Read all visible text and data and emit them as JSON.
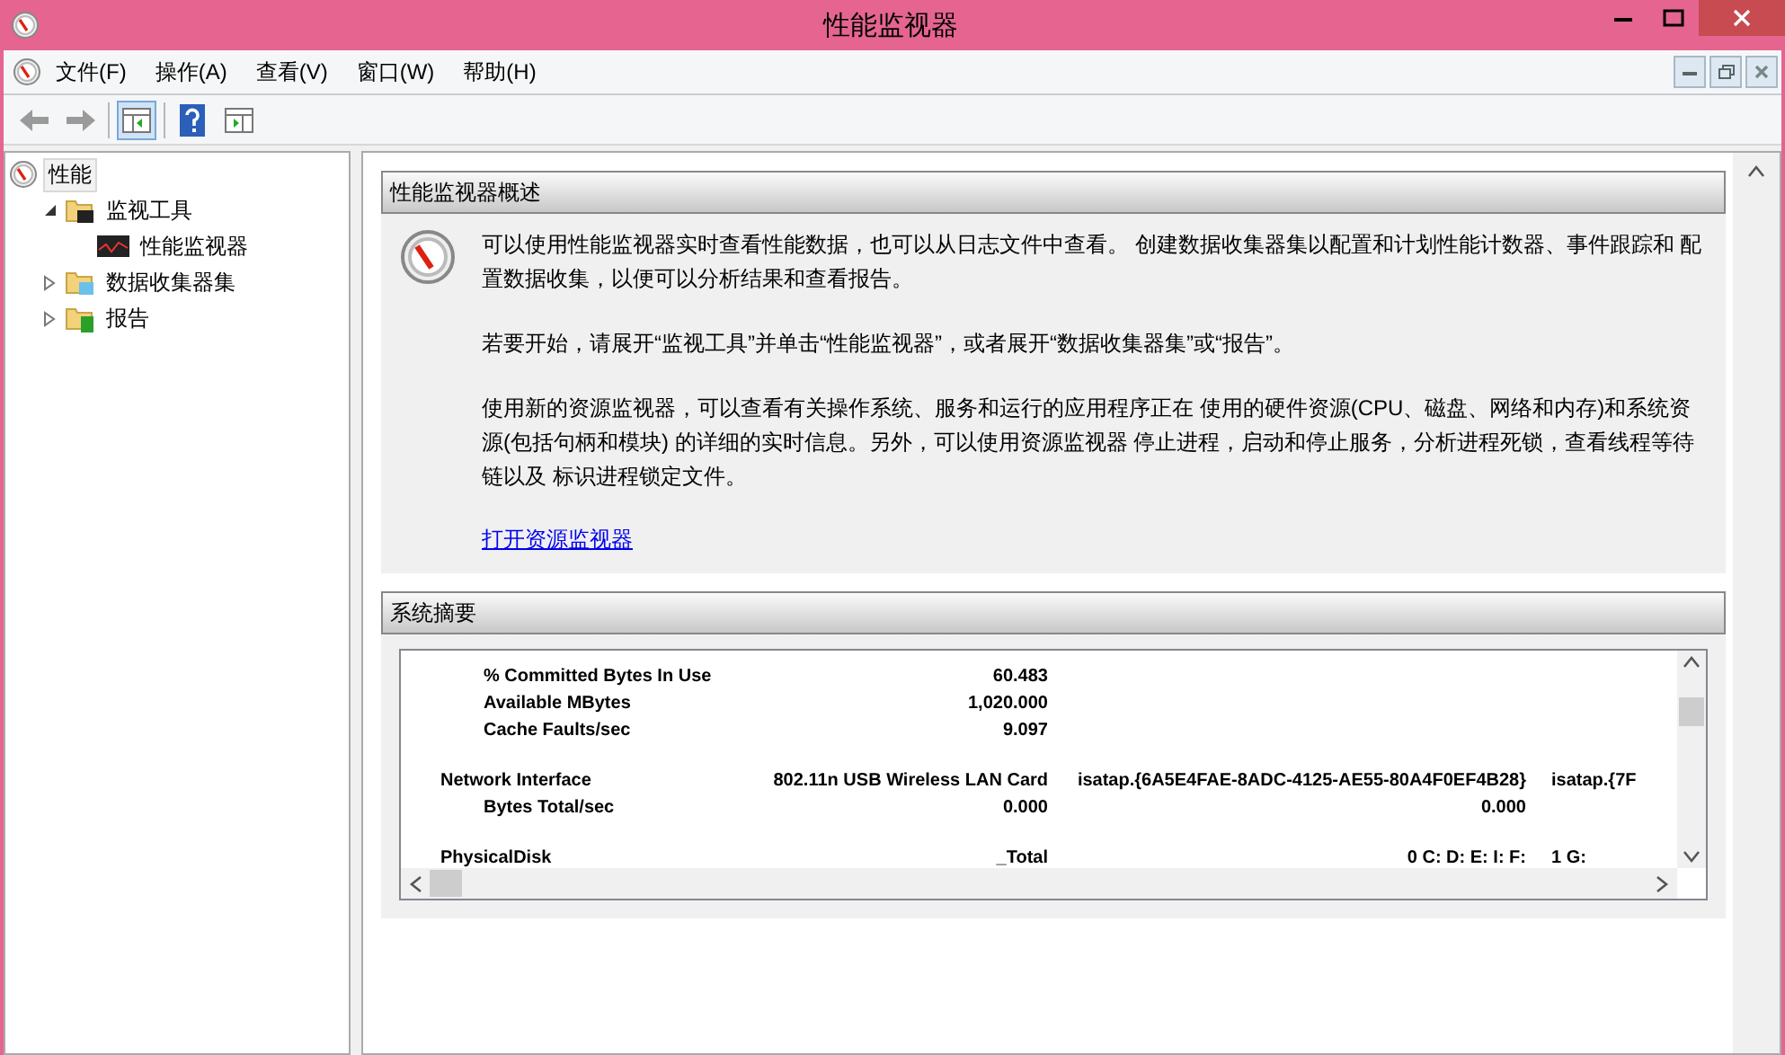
{
  "window": {
    "title": "性能监视器"
  },
  "menu": [
    "文件(F)",
    "操作(A)",
    "查看(V)",
    "窗口(W)",
    "帮助(H)"
  ],
  "toolbar": [
    {
      "kind": "back"
    },
    {
      "kind": "forward"
    },
    {
      "kind": "tree",
      "selected": true
    },
    {
      "kind": "help"
    },
    {
      "kind": "action",
      "selected": false
    }
  ],
  "tree": [
    {
      "label": "性能",
      "kind": "gauge",
      "selected": true,
      "children": [
        {
          "label": "监视工具",
          "kind": "folder-monitor",
          "expanded": true,
          "children": [
            {
              "label": "性能监视器",
              "kind": "graph"
            }
          ]
        },
        {
          "label": "数据收集器集",
          "kind": "folder-data",
          "expanded": false
        },
        {
          "label": "报告",
          "kind": "folder-report",
          "expanded": false
        }
      ]
    }
  ],
  "overview": {
    "title": "性能监视器概述",
    "paragraphs": [
      "可以使用性能监视器实时查看性能数据，也可以从日志文件中查看。 创建数据收集器集以配置和计划性能计数器、事件跟踪和 配置数据收集，以便可以分析结果和查看报告。",
      "若要开始，请展开“监视工具”并单击“性能监视器”，或者展开“数据收集器集”或“报告”。",
      "使用新的资源监视器，可以查看有关操作系统、服务和运行的应用程序正在 使用的硬件资源(CPU、磁盘、网络和内存)和系统资源(包括句柄和模块) 的详细的实时信息。另外，可以使用资源监视器 停止进程，启动和停止服务，分析进程死锁，查看线程等待链以及 标识进程锁定文件。"
    ],
    "link": "打开资源监视器"
  },
  "summary": {
    "title": "系统摘要",
    "groups": [
      {
        "counters": [
          {
            "name": "% Committed Bytes In Use",
            "values": [
              "60.483"
            ]
          },
          {
            "name": "Available MBytes",
            "values": [
              "1,020.000"
            ]
          },
          {
            "name": "Cache Faults/sec",
            "values": [
              "9.097"
            ]
          }
        ]
      },
      {
        "name": "Network Interface",
        "instances": [
          "802.11n USB Wireless LAN Card",
          "isatap.{6A5E4FAE-8ADC-4125-AE55-80A4F0EF4B28}",
          "isatap.{7F"
        ],
        "counters": [
          {
            "name": "Bytes Total/sec",
            "values": [
              "0.000",
              "0.000"
            ]
          }
        ]
      },
      {
        "name": "PhysicalDisk",
        "instances": [
          "_Total",
          "0 C: D: E: I: F:",
          "1 G:"
        ]
      }
    ]
  }
}
